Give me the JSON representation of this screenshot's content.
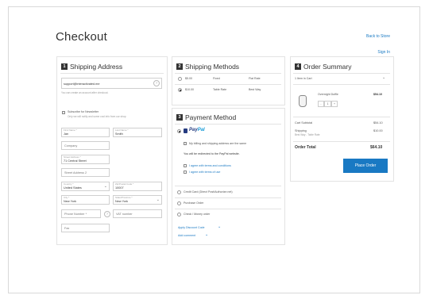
{
  "header": {
    "title": "Checkout",
    "back_link": "Back to Store",
    "sign_in": "Sign In"
  },
  "shipping": {
    "step": "1",
    "heading": "Shipping Address",
    "email_value": "support@interactivated.me",
    "email_hint": "You can create an account after checkout.",
    "subscribe_label": "Subscribe for Newsletter",
    "subscribe_sub": "Only we will notify and some cool info from our shop",
    "firstname_label": "First Name *",
    "firstname_value": "Jan",
    "lastname_label": "Last Name *",
    "lastname_value": "Smith",
    "company_placeholder": "Company",
    "street_label": "Street Address *",
    "street_value": "71 Central Street",
    "street2_placeholder": "Street Address 2",
    "country_label": "Country *",
    "country_value": "United States",
    "zip_label": "Zip/Postal Code *",
    "zip_value": "10007",
    "city_label": "City *",
    "city_value": "New York",
    "region_label": "State/Province *",
    "region_value": "New York",
    "phone_placeholder": "Phone Number *",
    "vat_placeholder": "VAT number",
    "fax_placeholder": "Fax"
  },
  "methods": {
    "step": "2",
    "heading": "Shipping Methods",
    "rows": [
      {
        "price": "$5.00",
        "name": "Fixed",
        "carrier": "Flat Rate"
      },
      {
        "price": "$10.00",
        "name": "Table Rate",
        "carrier": "Best Way"
      }
    ]
  },
  "payment": {
    "step": "3",
    "heading": "Payment Method",
    "paypal_a": "Pay",
    "paypal_b": "Pal",
    "same_address": "My billing and shipping address are the same",
    "redirect_note": "You will be redirected to the PayPal website.",
    "agree1": "I agree with terms and conditions",
    "agree2": "I agree with terms of use",
    "options": [
      "Credit Card (Direct Post/Authorize.net)",
      "Purchase Order",
      "Check / Money order"
    ],
    "discount_link": "Apply Discount Code",
    "comment_link": "Add comment"
  },
  "summary": {
    "step": "4",
    "heading": "Order Summary",
    "items_in_cart": "1 Item in Cart",
    "product_name": "Overnight Duffle",
    "product_price": "$54.10",
    "qty": "1",
    "subtotal_label": "Cart Subtotal",
    "subtotal_value": "$54.10",
    "shipping_label": "Shipping",
    "shipping_sub": "Best Way - Table Rate",
    "shipping_value": "$10.00",
    "total_label": "Order Total",
    "total_value": "$64.10",
    "place_order": "Place Order"
  },
  "colors": {
    "accent": "#1979c3",
    "step_badge": "#333333"
  }
}
